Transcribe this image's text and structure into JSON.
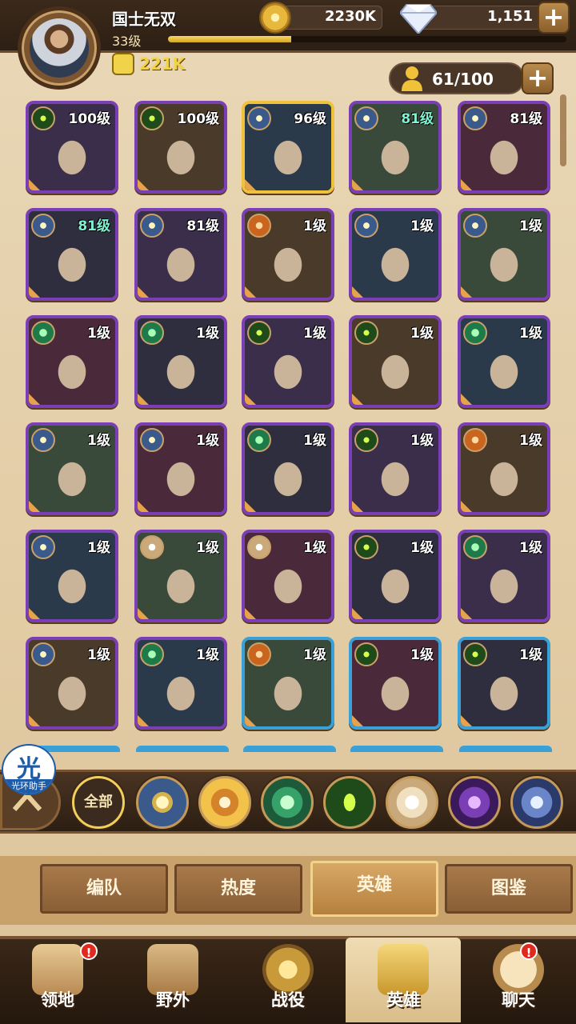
{
  "player": {
    "name": "国士无双",
    "level": "33级",
    "xp_fraction": 0.31,
    "power": "221K"
  },
  "currency": {
    "gold": "2230K",
    "gems": "1,151"
  },
  "hero_count": "61/100",
  "heroes": [
    {
      "level": "100级",
      "faction": "f-eye",
      "frame": "purple",
      "teal": false
    },
    {
      "level": "100级",
      "faction": "f-eye",
      "frame": "purple",
      "teal": false
    },
    {
      "level": "96级",
      "faction": "f-light",
      "frame": "gold",
      "teal": false
    },
    {
      "level": "81级",
      "faction": "f-light",
      "frame": "purple",
      "teal": true
    },
    {
      "level": "81级",
      "faction": "f-light",
      "frame": "purple",
      "teal": false
    },
    {
      "level": "81级",
      "faction": "f-light",
      "frame": "purple",
      "teal": true
    },
    {
      "level": "81级",
      "faction": "f-light",
      "frame": "purple",
      "teal": false
    },
    {
      "level": "1级",
      "faction": "f-mauler",
      "frame": "purple",
      "teal": false
    },
    {
      "level": "1级",
      "faction": "f-light",
      "frame": "purple",
      "teal": false
    },
    {
      "level": "1级",
      "faction": "f-light",
      "frame": "purple",
      "teal": false
    },
    {
      "level": "1级",
      "faction": "f-wild",
      "frame": "purple",
      "teal": false
    },
    {
      "level": "1级",
      "faction": "f-wild",
      "frame": "purple",
      "teal": false
    },
    {
      "level": "1级",
      "faction": "f-eye",
      "frame": "purple",
      "teal": false
    },
    {
      "level": "1级",
      "faction": "f-eye",
      "frame": "purple",
      "teal": false
    },
    {
      "level": "1级",
      "faction": "f-wild",
      "frame": "purple",
      "teal": false
    },
    {
      "level": "1级",
      "faction": "f-light",
      "frame": "purple",
      "teal": false
    },
    {
      "level": "1级",
      "faction": "f-light",
      "frame": "purple",
      "teal": false
    },
    {
      "level": "1级",
      "faction": "f-wild",
      "frame": "purple",
      "teal": false
    },
    {
      "level": "1级",
      "faction": "f-eye",
      "frame": "purple",
      "teal": false
    },
    {
      "level": "1级",
      "faction": "f-mauler",
      "frame": "purple",
      "teal": false
    },
    {
      "level": "1级",
      "faction": "f-light",
      "frame": "purple",
      "teal": false
    },
    {
      "level": "1级",
      "faction": "f-celest",
      "frame": "purple",
      "teal": false
    },
    {
      "level": "1级",
      "faction": "f-celest",
      "frame": "purple",
      "teal": false
    },
    {
      "level": "1级",
      "faction": "f-eye",
      "frame": "purple",
      "teal": false
    },
    {
      "level": "1级",
      "faction": "f-wild",
      "frame": "purple",
      "teal": false
    },
    {
      "level": "1级",
      "faction": "f-light",
      "frame": "purple",
      "teal": false
    },
    {
      "level": "1级",
      "faction": "f-wild",
      "frame": "purple",
      "teal": false
    },
    {
      "level": "1级",
      "faction": "f-mauler",
      "frame": "blue",
      "teal": false
    },
    {
      "level": "1级",
      "faction": "f-eye",
      "frame": "blue",
      "teal": false
    },
    {
      "level": "1级",
      "faction": "f-eye",
      "frame": "blue",
      "teal": false
    }
  ],
  "filters": {
    "all_label": "全部"
  },
  "helper": {
    "big": "光",
    "sub": "光环助手"
  },
  "subtabs": [
    "编队",
    "热度",
    "英雄",
    "图鉴"
  ],
  "nav": [
    "领地",
    "野外",
    "战役",
    "英雄",
    "聊天"
  ],
  "nav_badge": "!"
}
